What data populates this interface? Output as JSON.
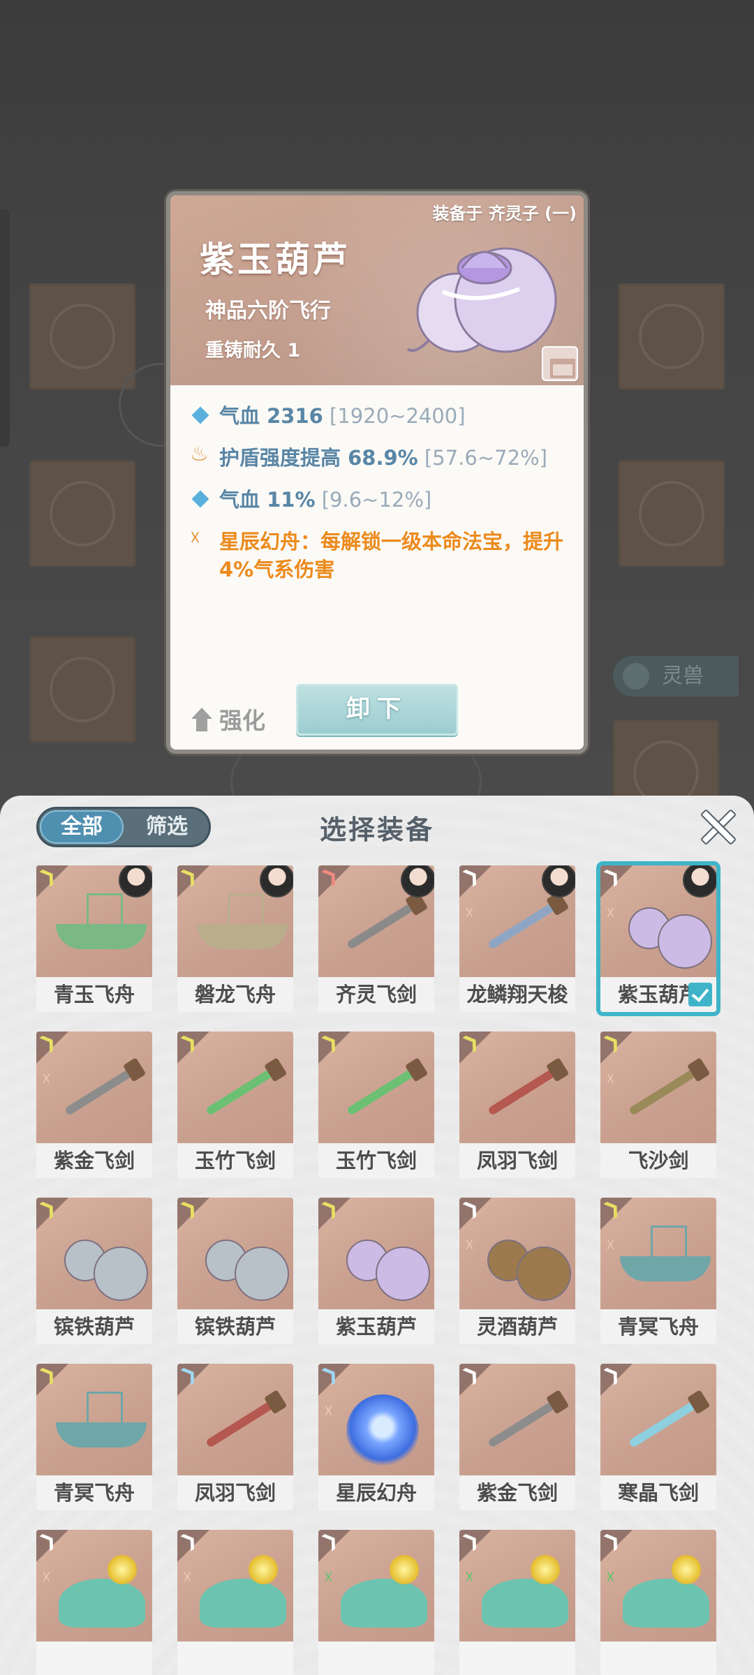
{
  "detail": {
    "equipped_on": "装备于 齐灵子 (一)",
    "title": "紫玉葫芦",
    "grade": "神品六阶飞行",
    "durability": "重铸耐久 1",
    "stats": [
      {
        "icon": "diamond",
        "name": "气血 2316",
        "range": "[1920~2400]"
      },
      {
        "icon": "flame",
        "name": "护盾强度提高 68.9%",
        "range": "[57.6~72%]"
      },
      {
        "icon": "diamond",
        "name": "气血 11%",
        "range": "[9.6~12%]"
      }
    ],
    "special": "星辰幻舟：每解锁一级本命法宝，提升4%气系伤害",
    "strengthen_label": "强化",
    "unequip_label": "卸下"
  },
  "panel": {
    "title": "选择装备",
    "tabs": [
      {
        "label": "全部",
        "active": true
      },
      {
        "label": "筛选",
        "active": false
      }
    ]
  },
  "items": [
    {
      "name": "青玉飞舟",
      "kind": "boat",
      "wing": "gold",
      "color": "#7ab886",
      "portrait": true,
      "sigil": false
    },
    {
      "name": "磐龙飞舟",
      "kind": "boat",
      "wing": "gold",
      "color": "#b9ad8c",
      "portrait": true,
      "sigil": false
    },
    {
      "name": "齐灵飞剑",
      "kind": "sword",
      "wing": "red",
      "color": "#8a8a8a",
      "portrait": true,
      "sigil": false
    },
    {
      "name": "龙鳞翔天梭",
      "kind": "sword",
      "wing": "white",
      "color": "#8ea6c4",
      "portrait": true,
      "sigil": true
    },
    {
      "name": "紫玉葫芦",
      "kind": "gourd",
      "wing": "white",
      "color": "#cdbbe6",
      "portrait": true,
      "sigil": true,
      "selected": true
    },
    {
      "name": "紫金飞剑",
      "kind": "sword",
      "wing": "gold",
      "color": "#8c8c8c",
      "portrait": false,
      "sigil": true
    },
    {
      "name": "玉竹飞剑",
      "kind": "sword",
      "wing": "gold",
      "color": "#6cc074",
      "portrait": false,
      "sigil": false
    },
    {
      "name": "玉竹飞剑",
      "kind": "sword",
      "wing": "gold",
      "color": "#6cc074",
      "portrait": false,
      "sigil": false
    },
    {
      "name": "凤羽飞剑",
      "kind": "sword",
      "wing": "gold",
      "color": "#b5584f",
      "portrait": false,
      "sigil": false
    },
    {
      "name": "飞沙剑",
      "kind": "sword",
      "wing": "gold",
      "color": "#9a8a5a",
      "portrait": false,
      "sigil": true
    },
    {
      "name": "镔铁葫芦",
      "kind": "gourd",
      "wing": "gold",
      "color": "#b8c0c8",
      "portrait": false,
      "sigil": false
    },
    {
      "name": "镔铁葫芦",
      "kind": "gourd",
      "wing": "gold",
      "color": "#b8c0c8",
      "portrait": false,
      "sigil": false
    },
    {
      "name": "紫玉葫芦",
      "kind": "gourd",
      "wing": "gold",
      "color": "#cdbbe6",
      "portrait": false,
      "sigil": false
    },
    {
      "name": "灵酒葫芦",
      "kind": "gourd",
      "wing": "white",
      "color": "#9c7a4e",
      "portrait": false,
      "sigil": true
    },
    {
      "name": "青冥飞舟",
      "kind": "boat",
      "wing": "gold",
      "color": "#6fa6a8",
      "portrait": false,
      "sigil": true
    },
    {
      "name": "青冥飞舟",
      "kind": "boat",
      "wing": "gold",
      "color": "#6fa6a8",
      "portrait": false,
      "sigil": false
    },
    {
      "name": "凤羽飞剑",
      "kind": "sword",
      "wing": "blue",
      "color": "#b5584f",
      "portrait": false,
      "sigil": false
    },
    {
      "name": "星辰幻舟",
      "kind": "orb",
      "wing": "blue",
      "color": "#5a86ee",
      "portrait": false,
      "sigil": true
    },
    {
      "name": "紫金飞剑",
      "kind": "sword",
      "wing": "white",
      "color": "#8c8c8c",
      "portrait": false,
      "sigil": false
    },
    {
      "name": "寒晶飞剑",
      "kind": "sword",
      "wing": "white",
      "color": "#8ecfe0",
      "portrait": false,
      "sigil": false
    },
    {
      "name": "",
      "kind": "lotus",
      "wing": "white",
      "color": "#6cc4b0",
      "portrait": false,
      "sigil": true
    },
    {
      "name": "",
      "kind": "lotus",
      "wing": "white",
      "color": "#6cc4b0",
      "portrait": false,
      "sigil": true
    },
    {
      "name": "",
      "kind": "lotus",
      "wing": "white",
      "color": "#6cc4b0",
      "portrait": false,
      "sigil": true,
      "sigil_green": true
    },
    {
      "name": "",
      "kind": "lotus",
      "wing": "white",
      "color": "#6cc4b0",
      "portrait": false,
      "sigil": true,
      "sigil_green": true
    },
    {
      "name": "",
      "kind": "lotus",
      "wing": "white",
      "color": "#6cc4b0",
      "portrait": false,
      "sigil": true,
      "sigil_green": true
    }
  ]
}
